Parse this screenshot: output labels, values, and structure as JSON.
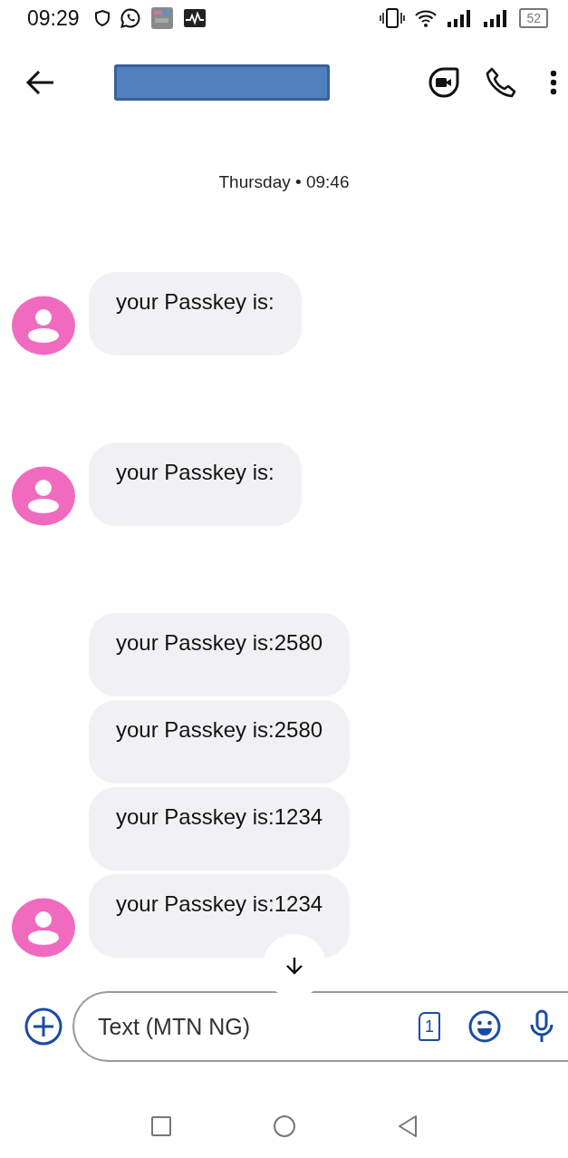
{
  "status_bar": {
    "time": "09:29",
    "battery": "52"
  },
  "header": {
    "contact_hidden": true
  },
  "timestamp": "Thursday • 09:46",
  "groups": [
    {
      "messages": [
        {
          "text": "your Passkey is:"
        }
      ]
    },
    {
      "messages": [
        {
          "text": "your Passkey is:"
        }
      ]
    },
    {
      "messages": [
        {
          "text": "your Passkey is:2580"
        },
        {
          "text": "your Passkey is:2580"
        },
        {
          "text": "your Passkey is:1234"
        },
        {
          "text": "your Passkey is:1234"
        }
      ]
    }
  ],
  "composer": {
    "placeholder": "Text (MTN NG)",
    "sim": "1"
  }
}
